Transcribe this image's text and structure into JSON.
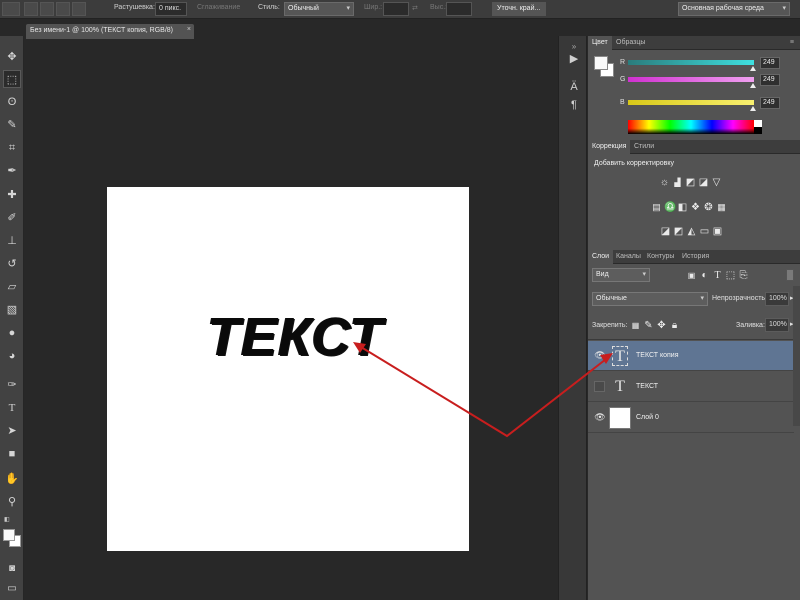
{
  "options_bar": {
    "feather_label": "Растушевка:",
    "feather_value": "0 пикс.",
    "antialias_label": "Сглаживание",
    "style_label": "Стиль:",
    "style_value": "Обычный",
    "width_label": "Шир.:",
    "height_label": "Выс.:",
    "refine_button": "Уточн. край...",
    "workspace_value": "Основная рабочая среда"
  },
  "document": {
    "tab_title": "Без имени-1 @ 100% (ТЕКСТ копия, RGB/8)",
    "close_symbol": "×",
    "canvas_text": "ТЕКСТ"
  },
  "color_panel": {
    "tabs": [
      "Цвет",
      "Образцы"
    ],
    "channels": [
      {
        "label": "R",
        "value": "249",
        "color": "#3fd0d0",
        "level": 249
      },
      {
        "label": "G",
        "value": "249",
        "color": "#d040d0",
        "level": 249
      },
      {
        "label": "B",
        "value": "249",
        "color": "#e0d020",
        "level": 249
      }
    ]
  },
  "adjustments_panel": {
    "tabs": [
      "Коррекция",
      "Стили"
    ],
    "heading": "Добавить корректировку"
  },
  "layers_panel": {
    "tabs": [
      "Слои",
      "Каналы",
      "Контуры",
      "История"
    ],
    "filter_value": "Вид",
    "blend_mode": "Обычные",
    "opacity_label": "Непрозрачность:",
    "opacity_value": "100%",
    "lock_label": "Закрепить:",
    "fill_label": "Заливка:",
    "fill_value": "100%",
    "layers": [
      {
        "name": "ТЕКСТ копия",
        "type": "text",
        "selected": true,
        "visible": true
      },
      {
        "name": "ТЕКСТ",
        "type": "text",
        "selected": false,
        "visible": false
      },
      {
        "name": "Слой 0",
        "type": "pixel",
        "selected": false,
        "visible": true
      }
    ]
  },
  "annotation": {
    "arrow_color": "#c81e1e"
  }
}
